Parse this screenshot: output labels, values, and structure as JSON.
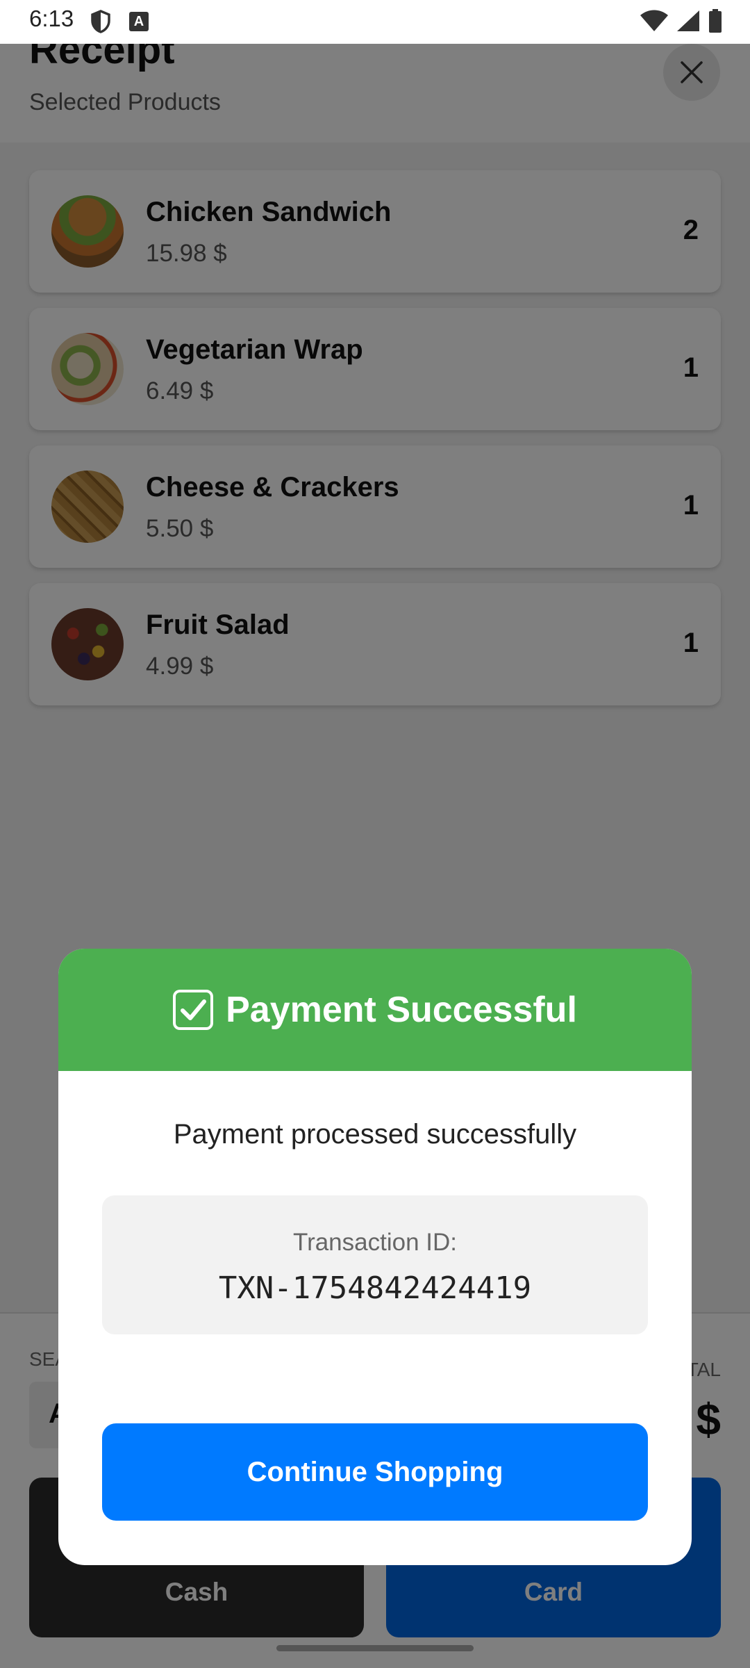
{
  "status_bar": {
    "time": "6:13"
  },
  "header": {
    "title": "Receipt",
    "subtitle": "Selected Products"
  },
  "products": [
    {
      "name": "Chicken Sandwich",
      "price": "15.98 $",
      "qty": "2"
    },
    {
      "name": "Vegetarian Wrap",
      "price": "6.49 $",
      "qty": "1"
    },
    {
      "name": "Cheese & Crackers",
      "price": "5.50 $",
      "qty": "1"
    },
    {
      "name": "Fruit Salad",
      "price": "4.99 $",
      "qty": "1"
    }
  ],
  "bottom": {
    "seat_label": "SEA",
    "seat_value": "A",
    "total_label": "TAL",
    "total_value": "$",
    "cash_label": "Cash",
    "card_label": "Card"
  },
  "dialog": {
    "title": "Payment Successful",
    "message": "Payment processed successfully",
    "txn_label": "Transaction ID:",
    "txn_value": "TXN-1754842424419",
    "button_label": "Continue Shopping"
  },
  "colors": {
    "success_green": "#4caf50",
    "primary_blue": "#007aff",
    "card_blue": "#0066e0"
  },
  "icons": [
    "shield-icon",
    "a-badge-icon",
    "wifi-icon",
    "signal-icon",
    "battery-icon",
    "close-icon",
    "check-icon"
  ]
}
